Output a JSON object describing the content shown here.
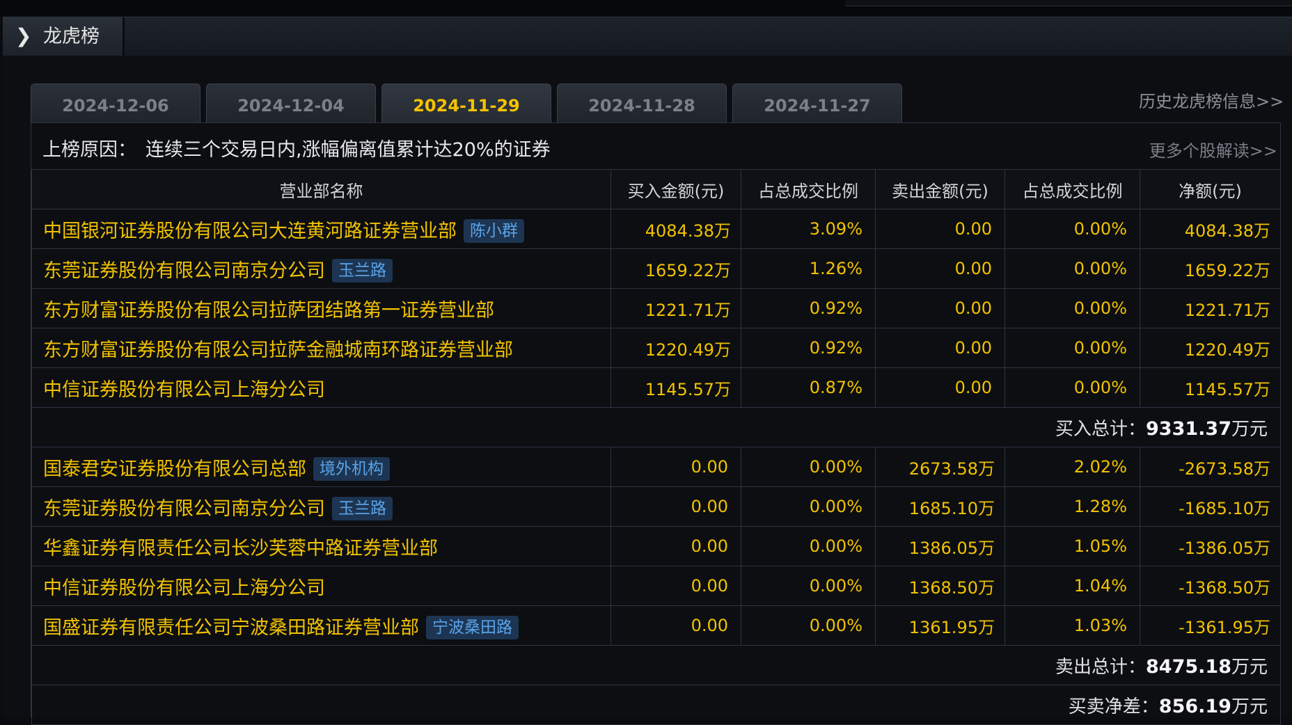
{
  "panel": {
    "title": "龙虎榜"
  },
  "tabs": [
    {
      "label": "2024-12-06",
      "active": false
    },
    {
      "label": "2024-12-04",
      "active": false
    },
    {
      "label": "2024-11-29",
      "active": true
    },
    {
      "label": "2024-11-28",
      "active": false
    },
    {
      "label": "2024-11-27",
      "active": false
    }
  ],
  "history_link": "历史龙虎榜信息>>",
  "reason": {
    "label": "上榜原因：",
    "text": "连续三个交易日内,涨幅偏离值累计达20%的证券",
    "more_link": "更多个股解读>>"
  },
  "columns": [
    "营业部名称",
    "买入金额(元)",
    "占总成交比例",
    "卖出金额(元)",
    "占总成交比例",
    "净额(元)"
  ],
  "buy_rows": [
    {
      "name": "中国银河证券股份有限公司大连黄河路证券营业部",
      "tag": "陈小群",
      "buy": "4084.38万",
      "buy_pct": "3.09%",
      "sell": "0.00",
      "sell_pct": "0.00%",
      "net": "4084.38万"
    },
    {
      "name": "东莞证券股份有限公司南京分公司",
      "tag": "玉兰路",
      "buy": "1659.22万",
      "buy_pct": "1.26%",
      "sell": "0.00",
      "sell_pct": "0.00%",
      "net": "1659.22万"
    },
    {
      "name": "东方财富证券股份有限公司拉萨团结路第一证券营业部",
      "tag": "",
      "buy": "1221.71万",
      "buy_pct": "0.92%",
      "sell": "0.00",
      "sell_pct": "0.00%",
      "net": "1221.71万"
    },
    {
      "name": "东方财富证券股份有限公司拉萨金融城南环路证券营业部",
      "tag": "",
      "buy": "1220.49万",
      "buy_pct": "0.92%",
      "sell": "0.00",
      "sell_pct": "0.00%",
      "net": "1220.49万"
    },
    {
      "name": "中信证券股份有限公司上海分公司",
      "tag": "",
      "buy": "1145.57万",
      "buy_pct": "0.87%",
      "sell": "0.00",
      "sell_pct": "0.00%",
      "net": "1145.57万"
    }
  ],
  "buy_total": {
    "label": "买入总计：",
    "value": "9331.37",
    "unit": "万元"
  },
  "sell_rows": [
    {
      "name": "国泰君安证券股份有限公司总部",
      "tag": "境外机构",
      "buy": "0.00",
      "buy_pct": "0.00%",
      "sell": "2673.58万",
      "sell_pct": "2.02%",
      "net": "-2673.58万"
    },
    {
      "name": "东莞证券股份有限公司南京分公司",
      "tag": "玉兰路",
      "buy": "0.00",
      "buy_pct": "0.00%",
      "sell": "1685.10万",
      "sell_pct": "1.28%",
      "net": "-1685.10万"
    },
    {
      "name": "华鑫证券有限责任公司长沙芙蓉中路证券营业部",
      "tag": "",
      "buy": "0.00",
      "buy_pct": "0.00%",
      "sell": "1386.05万",
      "sell_pct": "1.05%",
      "net": "-1386.05万"
    },
    {
      "name": "中信证券股份有限公司上海分公司",
      "tag": "",
      "buy": "0.00",
      "buy_pct": "0.00%",
      "sell": "1368.50万",
      "sell_pct": "1.04%",
      "net": "-1368.50万"
    },
    {
      "name": "国盛证券有限责任公司宁波桑田路证券营业部",
      "tag": "宁波桑田路",
      "buy": "0.00",
      "buy_pct": "0.00%",
      "sell": "1361.95万",
      "sell_pct": "1.03%",
      "net": "-1361.95万"
    }
  ],
  "sell_total": {
    "label": "卖出总计：",
    "value": "8475.18",
    "unit": "万元"
  },
  "net_total": {
    "label": "买卖净差：",
    "value": "856.19",
    "unit": "万元"
  }
}
